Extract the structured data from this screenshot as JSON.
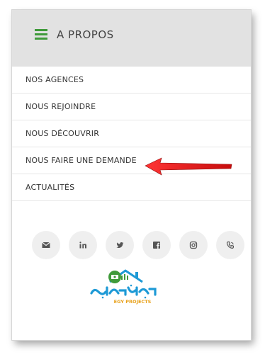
{
  "header": {
    "title": "A PROPOS"
  },
  "menu": {
    "items": [
      {
        "label": "NOS AGENCES"
      },
      {
        "label": "NOUS REJOINDRE"
      },
      {
        "label": "NOUS DÉCOUVRIR"
      },
      {
        "label": "NOUS FAIRE UNE DEMANDE"
      },
      {
        "label": "ACTUALITÉS"
      }
    ]
  },
  "social": {
    "icons": [
      "email-icon",
      "linkedin-icon",
      "twitter-icon",
      "facebook-icon",
      "instagram-icon",
      "phone-icon"
    ]
  },
  "logo": {
    "caption": "EGY PROJECTS"
  },
  "colors": {
    "accent": "#3f9a3a",
    "header_bg": "#e2e2e2",
    "arrow": "#e00000",
    "logo_blue": "#1e9ad6"
  }
}
